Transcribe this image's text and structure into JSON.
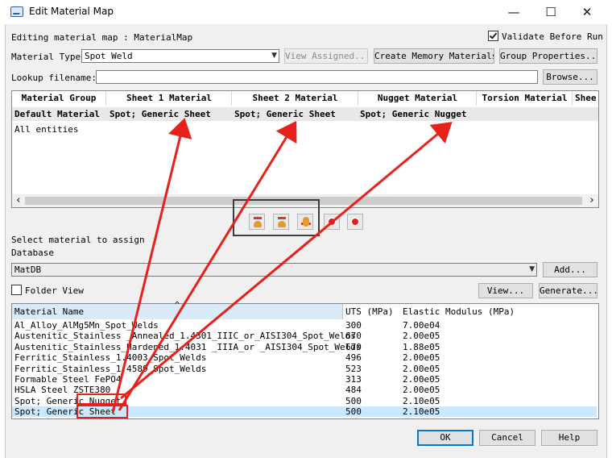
{
  "window": {
    "title": "Edit Material Map",
    "minimize_glyph": "—",
    "maximize_glyph": "☐",
    "close_glyph": "✕"
  },
  "header": {
    "editing_label": "Editing material map : MaterialMap",
    "validate_label": "Validate Before Run",
    "validate_checked": true
  },
  "material_type": {
    "label": "Material Type",
    "value": "Spot Weld",
    "view_assigned": "View Assigned...",
    "create_memory": "Create Memory Materials",
    "group_properties": "Group Properties..."
  },
  "lookup": {
    "label": "Lookup filename:",
    "value": "",
    "browse": "Browse..."
  },
  "map_table": {
    "columns": [
      "Material Group",
      "Sheet 1 Material",
      "Sheet 2 Material",
      "Nugget Material",
      "Torsion Material",
      "Shee"
    ],
    "rows": [
      {
        "group": "Default Material",
        "sheet1": "Spot; Generic Sheet",
        "sheet2": "Spot; Generic Sheet",
        "nugget": "Spot; Generic Nugget"
      },
      {
        "group": "All entities",
        "sheet1": "",
        "sheet2": "",
        "nugget": ""
      }
    ],
    "scroll_left": "‹",
    "scroll_right": "›"
  },
  "tools": [
    {
      "name": "assign-sheet1-icon"
    },
    {
      "name": "assign-sheet2-icon"
    },
    {
      "name": "assign-nugget-icon"
    },
    {
      "name": "record-icon"
    },
    {
      "name": "record-stop-icon"
    }
  ],
  "assign": {
    "label": "Select material to assign",
    "database_label": "Database",
    "database_value": "MatDB",
    "add": "Add...",
    "folder_view": "Folder View",
    "folder_view_checked": false,
    "view": "View...",
    "generate": "Generate..."
  },
  "materials": {
    "columns": [
      "Material Name",
      "UTS (MPa)",
      "Elastic Modulus (MPa)"
    ],
    "sort_glyph": "^",
    "rows": [
      {
        "name": "Al_Alloy_AlMg5Mn_Spot_Welds",
        "uts": "300",
        "modulus": "7.00e04"
      },
      {
        "name": "Austenitic_Stainless _Annealed_1.4301_IIIC_or_AISI304_Spot_Welds",
        "uts": "670",
        "modulus": "2.00e05"
      },
      {
        "name": "Austenitic_Stainless_Hardened_1.4031 _IIIA_or _AISI304_Spot_Welds",
        "uts": "670",
        "modulus": "1.88e05"
      },
      {
        "name": "Ferritic_Stainless_1.4003_Spot_Welds",
        "uts": "496",
        "modulus": "2.00e05"
      },
      {
        "name": "Ferritic_Stainless_1.4589_Spot_Welds",
        "uts": "523",
        "modulus": "2.00e05"
      },
      {
        "name": "Formable Steel FePO4",
        "uts": "313",
        "modulus": "2.00e05"
      },
      {
        "name": "HSLA Steel  ZSTE380",
        "uts": "484",
        "modulus": "2.00e05"
      },
      {
        "name": "Spot; Generic Nugget",
        "uts": "500",
        "modulus": "2.10e05"
      },
      {
        "name": "Spot; Generic Sheet",
        "uts": "500",
        "modulus": "2.10e05"
      }
    ],
    "selected_index": 8
  },
  "footer": {
    "ok": "OK",
    "cancel": "Cancel",
    "help": "Help"
  },
  "colors": {
    "annotation_red": "#e8201a",
    "selection": "#cce8ff",
    "accent": "#0078d7"
  }
}
